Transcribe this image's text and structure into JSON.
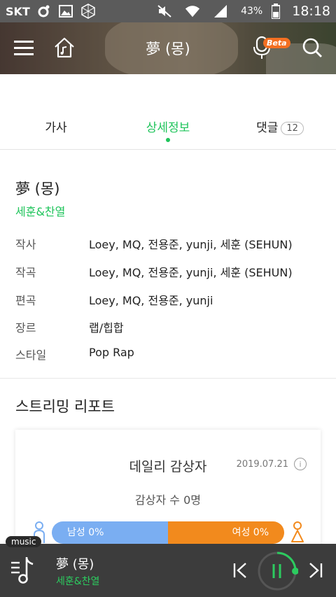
{
  "status_bar": {
    "carrier": "SKT",
    "battery": "43%",
    "time": "18:18",
    "icons": [
      "samsung-health-icon",
      "image-icon",
      "cube-icon",
      "mute-icon",
      "wifi-icon",
      "signal-icon"
    ]
  },
  "header": {
    "title": "夢 (몽)",
    "beta_label": "Beta",
    "icons": [
      "menu-icon",
      "home-music-icon",
      "mic-icon",
      "search-icon"
    ]
  },
  "tabs": [
    {
      "label": "가사",
      "active": false
    },
    {
      "label": "상세정보",
      "active": true
    },
    {
      "label": "댓글",
      "badge": "12",
      "active": false
    }
  ],
  "song": {
    "title": "夢 (몽)",
    "artist": "세훈&찬열"
  },
  "info": [
    {
      "key": "작사",
      "value": "Loey, MQ, 전용준, yunji, 세훈 (SEHUN)"
    },
    {
      "key": "작곡",
      "value": "Loey, MQ, 전용준, yunji, 세훈 (SEHUN)"
    },
    {
      "key": "편곡",
      "value": "Loey, MQ, 전용준, yunji"
    },
    {
      "key": "장르",
      "value": "랩/힙합"
    },
    {
      "key": "스타일",
      "value": "Pop Rap"
    }
  ],
  "report": {
    "section_title": "스트리밍 리포트",
    "card_title": "데일리 감상자",
    "date": "2019.07.21",
    "listener_count": "감상자 수 0명",
    "male_label": "남성 0%",
    "female_label": "여성 0%",
    "male_percent": 0,
    "female_percent": 0,
    "colors": {
      "male": "#7aaef2",
      "female": "#f28a1d"
    }
  },
  "player": {
    "tag": "music",
    "title": "夢 (몽)",
    "artist": "세훈&찬열",
    "state": "playing",
    "accent": "#2ccb5f"
  }
}
